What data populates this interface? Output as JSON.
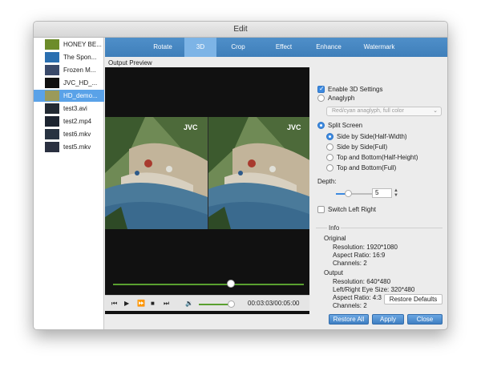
{
  "window": {
    "title": "Edit"
  },
  "files": [
    {
      "name": "HONEY BE...",
      "thumb_color": "#6c8c2a"
    },
    {
      "name": "The Spon...",
      "thumb_color": "#2a6fb0"
    },
    {
      "name": "Frozen M...",
      "thumb_color": "#3a4a6a"
    },
    {
      "name": "JVC_HD_...",
      "thumb_color": "#101010"
    },
    {
      "name": "HD_demo...",
      "thumb_color": "#9a9a5a",
      "selected": true
    },
    {
      "name": "test3.avi",
      "thumb_color": "#222a33"
    },
    {
      "name": "test2.mp4",
      "thumb_color": "#1c2430"
    },
    {
      "name": "test6.mkv",
      "thumb_color": "#283341"
    },
    {
      "name": "test5.mkv",
      "thumb_color": "#2a3040"
    }
  ],
  "tabs": [
    {
      "label": "Rotate"
    },
    {
      "label": "3D",
      "active": true
    },
    {
      "label": "Crop"
    },
    {
      "label": "Effect"
    },
    {
      "label": "Enhance"
    },
    {
      "label": "Watermark"
    }
  ],
  "preview": {
    "label": "Output Preview",
    "time": "00:03:03/00:05:00",
    "watermark": "JVC",
    "progress": 0.6,
    "volume": 0.9
  },
  "settings": {
    "enable_3d": "Enable 3D Settings",
    "anaglyph": "Anaglyph",
    "anaglyph_select": "Red/cyan anaglyph, full color",
    "split_screen": "Split Screen",
    "options": [
      {
        "label": "Side by Side(Half-Width)",
        "checked": true
      },
      {
        "label": "Side by Side(Full)"
      },
      {
        "label": "Top and Bottom(Half-Height)"
      },
      {
        "label": "Top and Bottom(Full)"
      }
    ],
    "depth_label": "Depth:",
    "depth_value": "5",
    "switch_lr": "Switch Left Right"
  },
  "info": {
    "title": "Info",
    "original_label": "Original",
    "original": [
      "Resolution: 1920*1080",
      "Aspect Ratio: 16:9",
      "Channels: 2"
    ],
    "output_label": "Output",
    "output": [
      "Resolution: 640*480",
      "Left/Right Eye Size: 320*480",
      "Aspect Ratio: 4:3",
      "Channels: 2"
    ]
  },
  "buttons": {
    "restore_defaults": "Restore Defaults",
    "restore_all": "Restore All",
    "apply": "Apply",
    "close": "Close"
  }
}
